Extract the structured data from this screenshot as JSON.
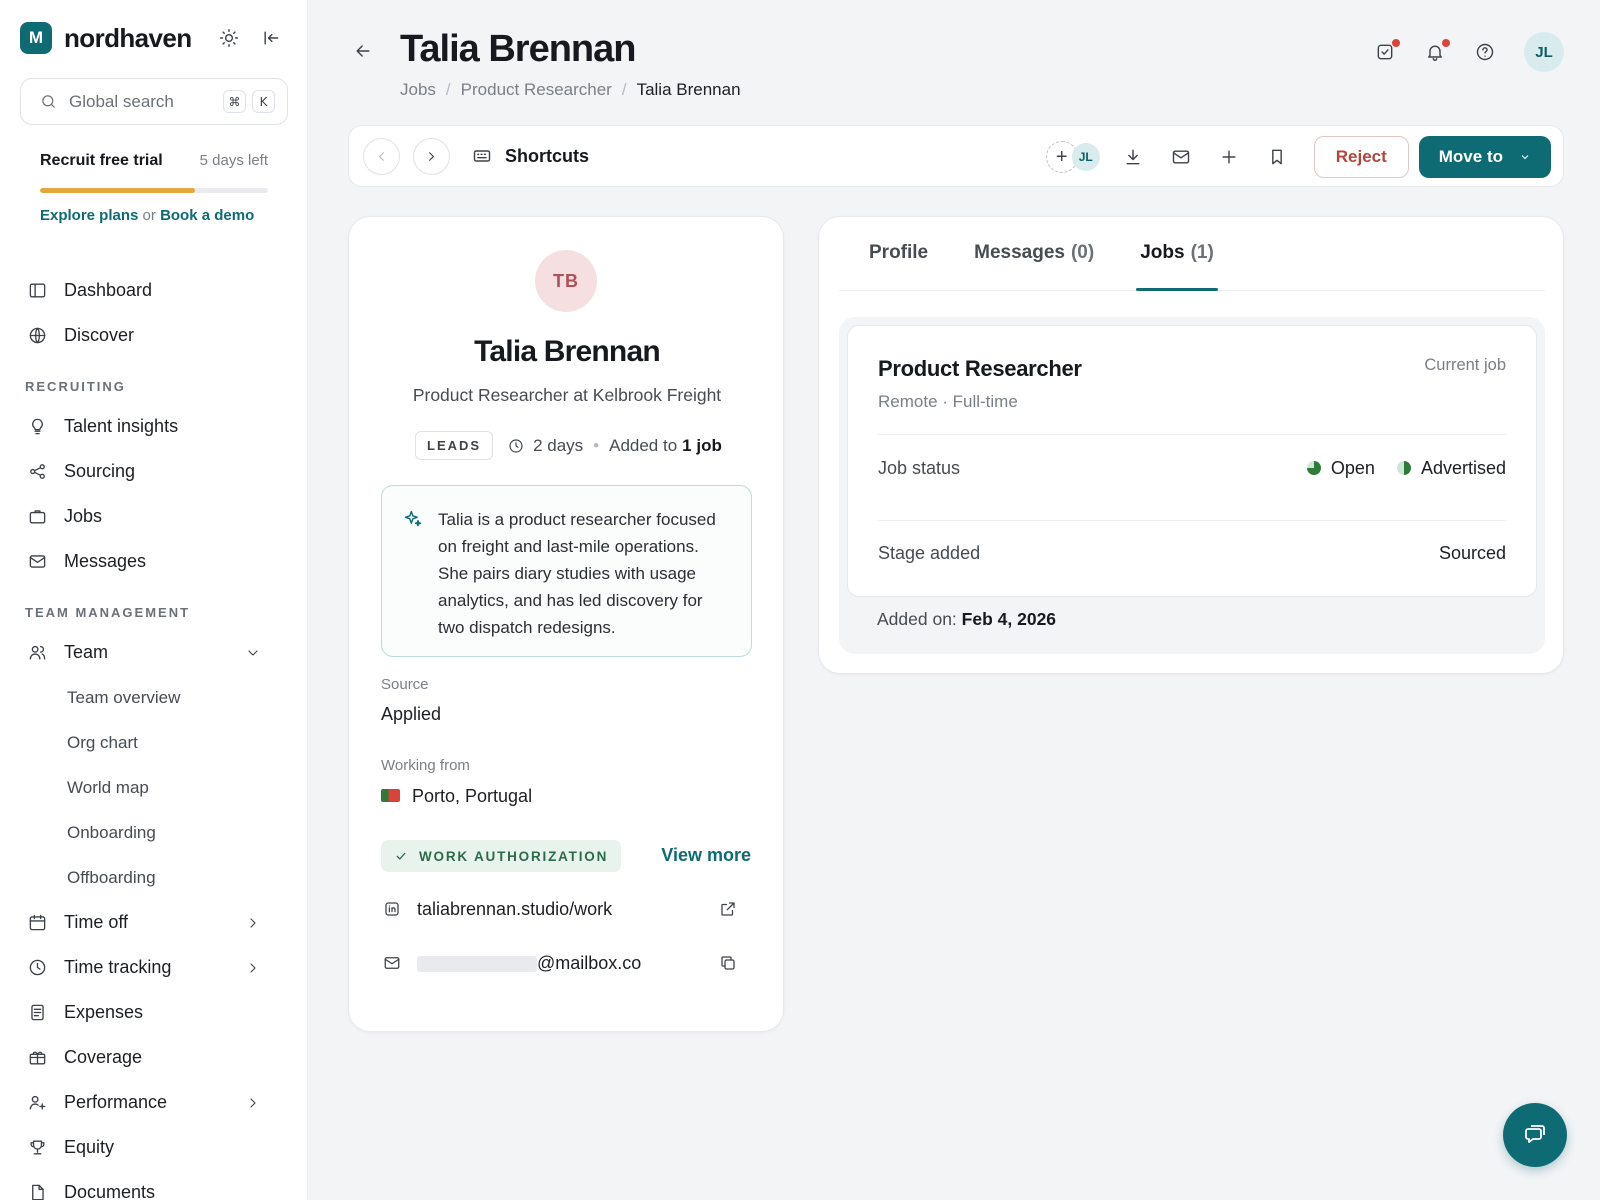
{
  "brand": {
    "mark": "M",
    "name": "nordhaven"
  },
  "search": {
    "placeholder": "Global search",
    "kbd1": "⌘",
    "kbd2": "K"
  },
  "trial": {
    "title": "Recruit free trial",
    "days_left": "5 days left",
    "progress": 0.68,
    "explore": "Explore plans",
    "or": "or",
    "demo": "Book a demo"
  },
  "nav": {
    "dashboard": "Dashboard",
    "discover": "Discover",
    "section_recruiting": "RECRUITING",
    "talent": "Talent insights",
    "sourcing": "Sourcing",
    "jobs": "Jobs",
    "messages": "Messages",
    "section_team": "TEAM MANAGEMENT",
    "team": "Team",
    "team_sub": [
      "Team overview",
      "Org chart",
      "World map",
      "Onboarding",
      "Offboarding"
    ],
    "timeoff": "Time off",
    "timetracking": "Time tracking",
    "expenses": "Expenses",
    "coverage": "Coverage",
    "performance": "Performance",
    "equity": "Equity",
    "documents": "Documents"
  },
  "header": {
    "title": "Talia Brennan",
    "breadcrumb": [
      "Jobs",
      "Product Researcher",
      "Talia Brennan"
    ],
    "avatar": "JL"
  },
  "toolbar": {
    "shortcuts": "Shortcuts",
    "assignee": "JL",
    "reject": "Reject",
    "move_to": "Move to"
  },
  "profile": {
    "initials": "TB",
    "name": "Talia Brennan",
    "headline": "Product Researcher at Kelbrook Freight",
    "badge": "LEADS",
    "age": "2 days",
    "added_prefix": "Added to",
    "added_count": "1 job",
    "summary": "Talia is a product researcher focused on freight and last-mile operations. She pairs diary studies with usage analytics, and has led discovery for two dispatch redesigns.",
    "source_label": "Source",
    "source_value": "Applied",
    "working_label": "Working from",
    "working_value": "Porto, Portugal",
    "auth_badge": "WORK AUTHORIZATION",
    "view_more": "View more",
    "website": "taliabrennan.studio/work",
    "email_domain": "@mailbox.co"
  },
  "tabs": [
    {
      "label": "Profile",
      "count": ""
    },
    {
      "label": "Messages",
      "count": "(0)"
    },
    {
      "label": "Jobs",
      "count": "(1)"
    }
  ],
  "job": {
    "title": "Product Researcher",
    "tag": "Current job",
    "sub": "Remote · Full-time",
    "status_label": "Job status",
    "status_open": "Open",
    "status_adv": "Advertised",
    "stage_label": "Stage added",
    "stage_value": "Sourced",
    "added_label": "Added on:",
    "added_value": "Feb 4, 2026"
  },
  "colors": {
    "accent": "#0f6b73",
    "reject": "#b2453c",
    "trial_bar": "#e3a73d",
    "status_green": "#2f7a3a",
    "notification": "#d9443c"
  }
}
